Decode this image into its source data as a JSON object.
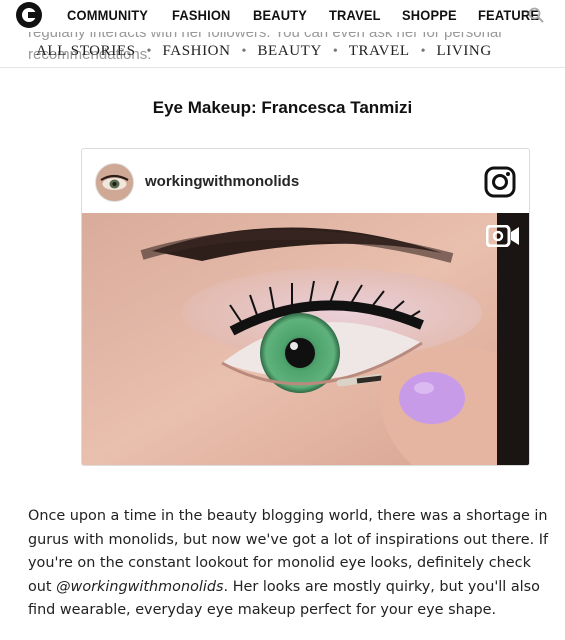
{
  "nav": {
    "items": [
      "COMMUNITY",
      "FASHION",
      "BEAUTY",
      "TRAVEL",
      "SHOPPE",
      "FEATURE"
    ]
  },
  "bleed_text": {
    "line1": "regularly interacts with her followers. You can even ask her for personal",
    "line2": "recommendations."
  },
  "subnav": {
    "items": [
      "ALL STORIES",
      "FASHION",
      "BEAUTY",
      "TRAVEL",
      "LIVING"
    ],
    "separator": "•"
  },
  "section_heading": "Eye Makeup: Francesca Tanmizi",
  "instagram": {
    "username": "workingwithmonolids"
  },
  "article": {
    "p1": "Once upon a time in the beauty blogging world, there was a shortage in gurus with monolids, but now we've got a lot of inspirations out there. If you're on the constant lookout for monolid eye looks, definitely check out ",
    "handle": "@workingwithmonolids",
    "p2": ". Her looks are mostly quirky, but you'll also find wearable, everyday eye makeup perfect for your eye shape."
  },
  "colors": {
    "iris": "#4fa36d",
    "nail": "#c79be8",
    "skin": "#e9bfae"
  }
}
